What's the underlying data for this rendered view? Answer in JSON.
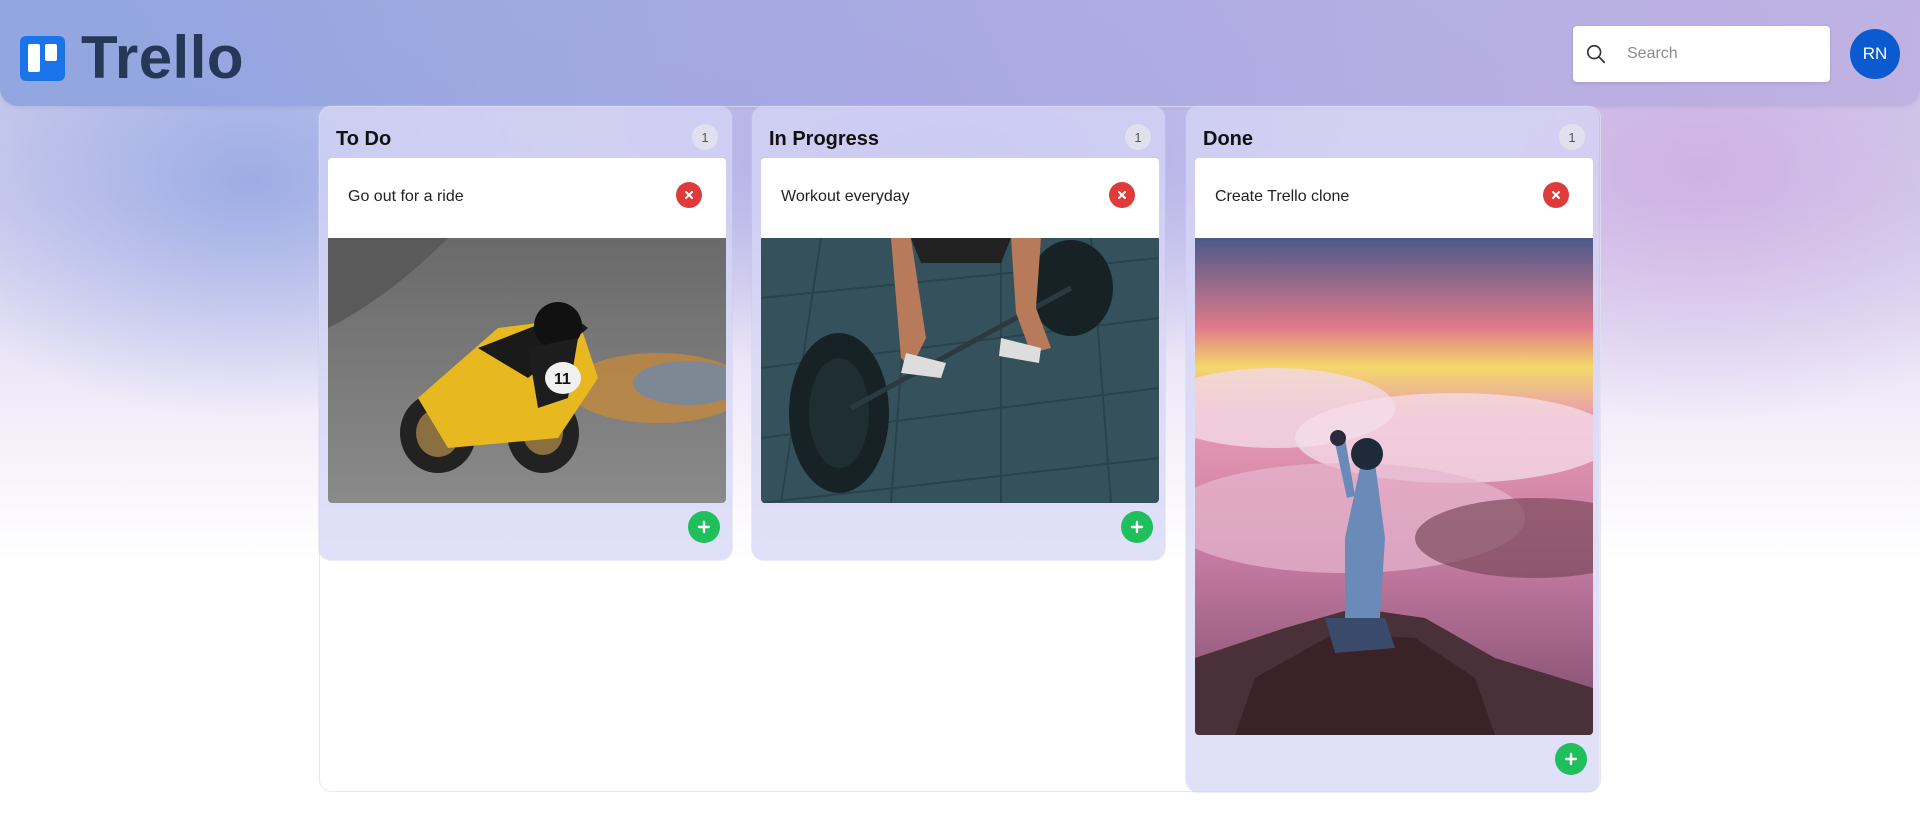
{
  "header": {
    "logo_text": "Trello",
    "search_placeholder": "Search",
    "avatar_initials": "RN"
  },
  "columns": [
    {
      "title": "To Do",
      "count": "1",
      "cards": [
        {
          "title": "Go out for a ride",
          "image": "motorcycle-racer-photo"
        }
      ]
    },
    {
      "title": "In Progress",
      "count": "1",
      "cards": [
        {
          "title": "Workout everyday",
          "image": "barbell-deadlift-photo"
        }
      ]
    },
    {
      "title": "Done",
      "count": "1",
      "cards": [
        {
          "title": "Create Trello clone",
          "image": "person-on-mountain-sunset-photo"
        }
      ]
    }
  ],
  "colors": {
    "accent": "#0b5ad0",
    "logo_blue": "#1a73e8",
    "logo_text": "#253858",
    "delete": "#e03b3b",
    "add": "#1fbf5b"
  }
}
